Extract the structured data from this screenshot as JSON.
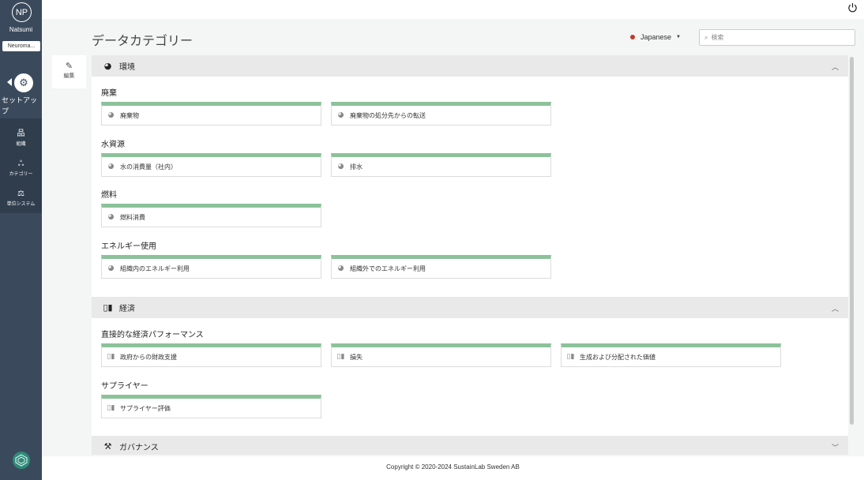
{
  "user": {
    "initials": "NP",
    "name": "Natsumi",
    "org": "Neuroma..."
  },
  "sidebar": {
    "setup_label": "セットアップ",
    "nav": [
      {
        "icon": "org-chart-icon",
        "label": "組織"
      },
      {
        "icon": "categories-icon",
        "label": "カテゴリー"
      },
      {
        "icon": "scale-icon",
        "label": "単位システム"
      }
    ]
  },
  "header": {
    "title": "データカテゴリー",
    "language": "Japanese",
    "search_placeholder": "検索"
  },
  "edit": {
    "label": "編集"
  },
  "sections": {
    "environment": {
      "title": "環境",
      "groups": {
        "waste": {
          "title": "廃棄",
          "items": [
            "廃棄物",
            "廃棄物の処分先からの転送"
          ]
        },
        "water": {
          "title": "水資源",
          "items": [
            "水の消費量（社内）",
            "排水"
          ]
        },
        "fuel": {
          "title": "燃料",
          "items": [
            "燃料消費"
          ]
        },
        "energy": {
          "title": "エネルギー使用",
          "items": [
            "組織内のエネルギー利用",
            "組織外でのエネルギー利用"
          ]
        }
      }
    },
    "economy": {
      "title": "経済",
      "groups": {
        "econ_perf": {
          "title": "直接的な経済パフォーマンス",
          "items": [
            "政府からの財政支援",
            "損失",
            "生成および分配された価値"
          ]
        },
        "supplier": {
          "title": "サプライヤー",
          "items": [
            "サプライヤー評価"
          ]
        }
      }
    },
    "governance": {
      "title": "ガバナンス"
    }
  },
  "footer": {
    "copyright": "Copyright © 2020-2024 SustainLab Sweden AB"
  },
  "colors": {
    "sidebar": "#3a4a5c",
    "card_accent": "#8cc29a",
    "language_dot": "#c0392b"
  }
}
